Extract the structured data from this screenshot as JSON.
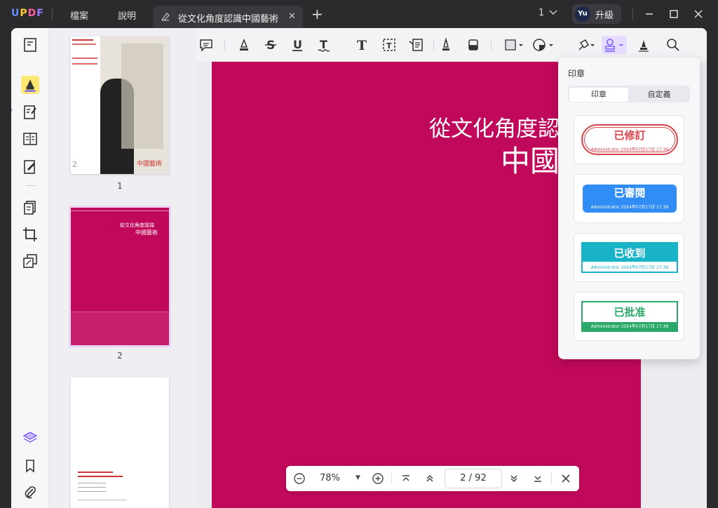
{
  "app": {
    "logo_text": "UPDF",
    "menu": [
      "檔案",
      "說明"
    ],
    "tab_title": "從文化角度認識中國藝術",
    "page_count_badge": "1",
    "user_initials": "Yu",
    "upgrade_label": "升級"
  },
  "thumbnails": [
    {
      "label": "1"
    },
    {
      "label": "2"
    },
    {
      "label": ""
    }
  ],
  "document": {
    "title_line1": "從文化角度認",
    "title_line2": "中國",
    "thumb2_line1": "從文化角度認識",
    "thumb2_line2": "中國藝術",
    "thumb1_caption": "中國藝術",
    "thumb1_number": "2",
    "page_color": "#c0095a"
  },
  "stamp_panel": {
    "title": "印章",
    "tabs": [
      "印章",
      "自定義"
    ],
    "stamps": [
      {
        "label": "已修訂",
        "sub": "Administrator 2024年07月17日 17:39",
        "color": "#d9434d"
      },
      {
        "label": "已審閱",
        "sub": "Administrator 2024年07月17日 17:39",
        "color": "#2f8df5"
      },
      {
        "label": "已收到",
        "sub": "Administrator 2024年07月17日 17:39",
        "color": "#19b3c8"
      },
      {
        "label": "已批准",
        "sub": "Administrator 2024年07月17日 17:39",
        "color": "#29a86a"
      }
    ]
  },
  "zoom": {
    "value": "78%",
    "current_page": "2",
    "total_pages": "92",
    "page_display": "2  /  92"
  },
  "colors": {
    "accent": "#7b5cff",
    "highlight_active": "#fde873"
  }
}
